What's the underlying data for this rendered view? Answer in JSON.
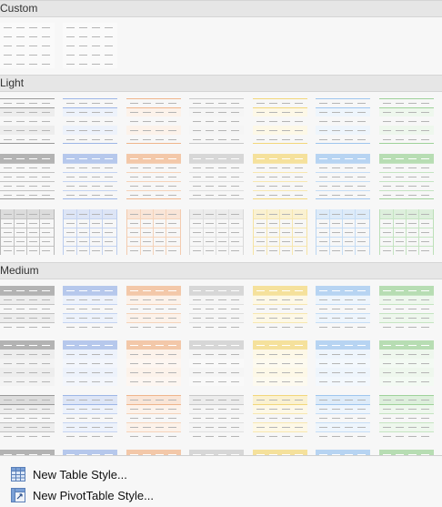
{
  "sections": {
    "custom": "Custom",
    "light": "Light",
    "medium": "Medium"
  },
  "palette": [
    "#9a9a9a",
    "#9db6e6",
    "#efb58c",
    "#c9c9c9",
    "#f2d77b",
    "#9fc6ee",
    "#9fd29a"
  ],
  "menu": {
    "new_table_style": "New Table Style...",
    "new_pivot_style": "New PivotTable Style..."
  },
  "icons": {
    "table": "table-icon",
    "pivot": "pivot-table-icon"
  }
}
